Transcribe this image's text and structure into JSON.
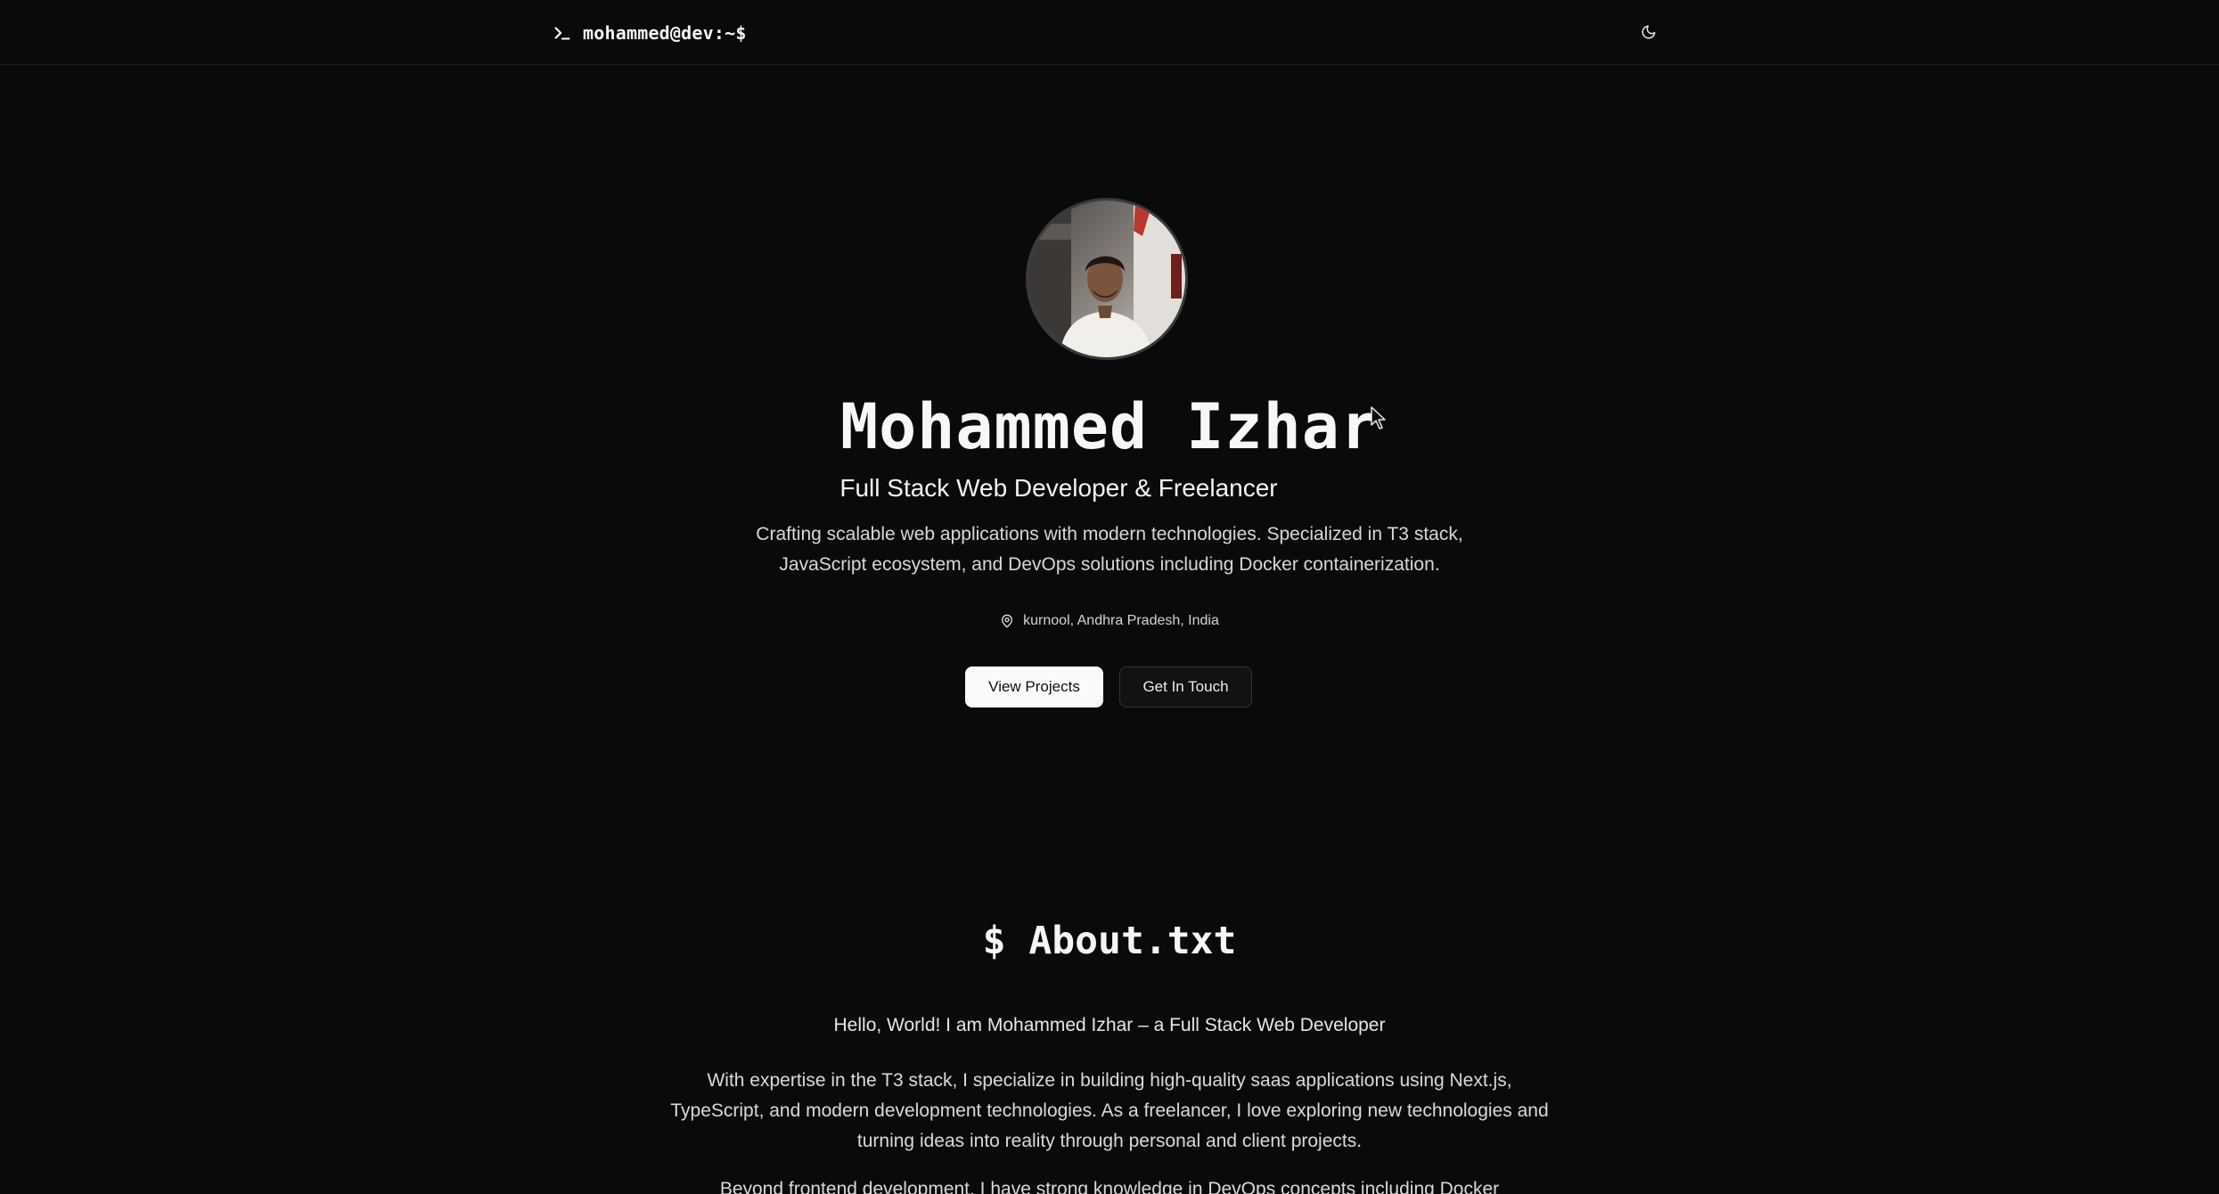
{
  "header": {
    "brand_text": "mohammed@dev:~$",
    "brand_icon": "terminal-prompt-icon",
    "theme_icon": "moon-icon"
  },
  "hero": {
    "avatar_alt": "profile-photo",
    "name": "Mohammed Izhar",
    "role": "Full Stack Web Developer & Freelancer",
    "tagline": "Crafting scalable web applications with modern technologies. Specialized in T3 stack, JavaScript ecosystem, and DevOps solutions including Docker containerization.",
    "location_icon": "map-pin-icon",
    "location": "kurnool, Andhra Pradesh, India",
    "primary_button": "View Projects",
    "secondary_button": "Get In Touch"
  },
  "about": {
    "title": "$ About.txt",
    "hello": "Hello, World! I am Mohammed Izhar – a Full Stack Web Developer",
    "paragraph_1": "With expertise in the T3 stack, I specialize in building high-quality saas applications using Next.js, TypeScript, and modern development technologies. As a freelancer, I love exploring new technologies and turning ideas into reality through personal and client projects.",
    "paragraph_2": "Beyond frontend development, I have strong knowledge in DevOps concepts including Docker"
  },
  "colors": {
    "background": "#0a0a0b",
    "text": "#ededed",
    "primary_button_bg": "#fafafa",
    "secondary_button_border": "#333336"
  }
}
